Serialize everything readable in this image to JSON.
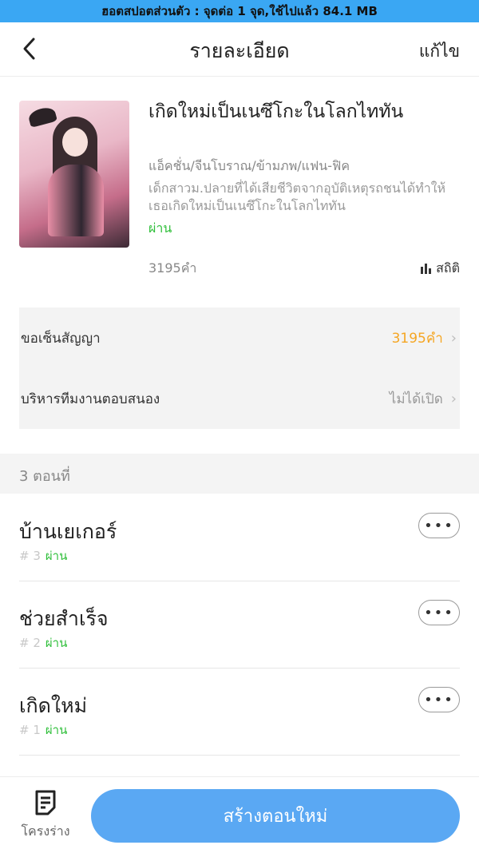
{
  "status_bar": {
    "hotspot_text": "ฮอตสปอตส่วนตัว : จุดต่อ 1 จุด,ใช้ไปแล้ว 84.1 MB"
  },
  "header": {
    "title": "รายละเอียด",
    "edit_label": "แก้ไข"
  },
  "book": {
    "title": "เกิดใหม่เป็นเนซึโกะในโลกไททัน",
    "genres": "แอ็คชั่น/จีนโบราณ/ข้ามภพ/แฟน-ฟิค",
    "description": "เด็กสาวม.ปลายที่ได้เสียชีวิตจากอุบัติเหตุรถชนได้ทำให้เธอเกิดใหม่เป็นเนซึโกะในโลกไททัน",
    "status": "ผ่าน",
    "word_count": "3195คำ",
    "stats_label": "สถิติ"
  },
  "panel": {
    "contract_label": "ขอเซ็นสัญญา",
    "contract_value": "3195คำ",
    "team_label": "บริหารทีมงานตอบสนอง",
    "team_value": "ไม่ได้เปิด"
  },
  "chapters_header": "3 ตอนที่",
  "chapters": [
    {
      "name": "บ้านเยเกอร์",
      "number": "# 3",
      "status": "ผ่าน"
    },
    {
      "name": "ช่วยสำเร็จ",
      "number": "# 2",
      "status": "ผ่าน"
    },
    {
      "name": "เกิดใหม่",
      "number": "# 1",
      "status": "ผ่าน"
    }
  ],
  "more_label": "•••",
  "bottom": {
    "draft_label": "โครงร่าง",
    "new_chapter_label": "สร้างตอนใหม่"
  },
  "colors": {
    "accent": "#5aa8f3",
    "status_green": "#2fbf3a",
    "orange": "#f5a623",
    "hotspot_bar": "#3aa7f3"
  },
  "icons": {
    "back": "chevron-left-icon",
    "stats": "bar-chart-icon",
    "draft": "draft-document-icon",
    "chevron": "chevron-right-icon",
    "more": "more-dots-icon"
  }
}
